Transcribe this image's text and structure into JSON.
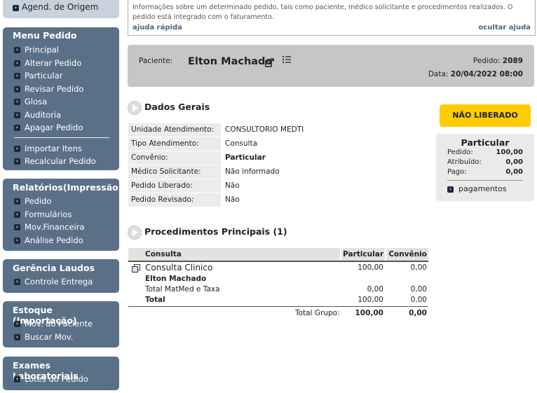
{
  "sidebar": {
    "top_item": "Agend. de Origem",
    "menu_pedido": {
      "title": "Menu Pedido",
      "items": [
        "Principal",
        "Alterar Pedido",
        "Particular",
        "Revisar Pedido",
        "Glosa",
        "Auditoria",
        "Apagar Pedido"
      ],
      "items2": [
        "Importar Itens",
        "Recalcular Pedido"
      ]
    },
    "relatorios": {
      "title": "Relatórios(Impressão)",
      "items": [
        "Pedido",
        "Formulários",
        "Mov.Financeira",
        "Análise Pedido"
      ]
    },
    "gerencia": {
      "title": "Gerência Laudos",
      "items": [
        "Controle Entrega"
      ]
    },
    "estoque": {
      "title": "Estoque (Importação)",
      "items": [
        "Mov. do Paciente",
        "Buscar Mov."
      ]
    },
    "exames": {
      "title": "Exames Laboratoriais",
      "items": [
        "Lotes do Pedido"
      ]
    }
  },
  "help": {
    "text": "Informações sobre um determinado pedido, tais como paciente, médico solicitante e procedimentos realizados. O pedido está integrado com o faturamento.",
    "quick": "ajuda rápida",
    "hide": "ocultar ajuda"
  },
  "patient": {
    "label": "Paciente:",
    "name": "Elton Machado",
    "pedido_label": "Pedido:",
    "pedido_num": "2089",
    "data_label": "Data:",
    "data_val": "20/04/2022 08:00"
  },
  "dados_gerais": {
    "title": "Dados Gerais",
    "rows": [
      {
        "k": "Unidade Atendimento:",
        "v": "CONSULTORIO MEDTI"
      },
      {
        "k": "Tipo Atendimento:",
        "v": "Consulta"
      },
      {
        "k": "Convênio:",
        "v": "Particular"
      },
      {
        "k": "Médico Solicitante:",
        "v": "Não informado"
      },
      {
        "k": "Pedido Liberado:",
        "v": "Não"
      },
      {
        "k": "Pedido Revisado:",
        "v": "Não"
      }
    ]
  },
  "status": {
    "badge": "NÃO LIBERADO",
    "card_title": "Particular",
    "pedido_label": "Pedido:",
    "pedido_val": "100,00",
    "atribuido_label": "Atribuído:",
    "atribuido_val": "0,00",
    "pago_label": "Pago:",
    "pago_val": "0,00",
    "pagamentos": "pagamentos"
  },
  "procedimentos": {
    "title": "Procedimentos Principais (1)",
    "headers": {
      "c1": "Consulta",
      "c2": "Particular",
      "c3": "Convênio"
    },
    "item_name": "Consulta Clinico",
    "item_part": "100,00",
    "item_conv": "0,00",
    "patient": "Elton Machado",
    "matmed_label": "Total MatMed e Taxa",
    "matmed_part": "0,00",
    "matmed_conv": "0,00",
    "total_label": "Total",
    "total_part": "100,00",
    "total_conv": "0,00",
    "grupo_label": "Total Grupo:",
    "grupo_part": "100,00",
    "grupo_conv": "0,00"
  }
}
